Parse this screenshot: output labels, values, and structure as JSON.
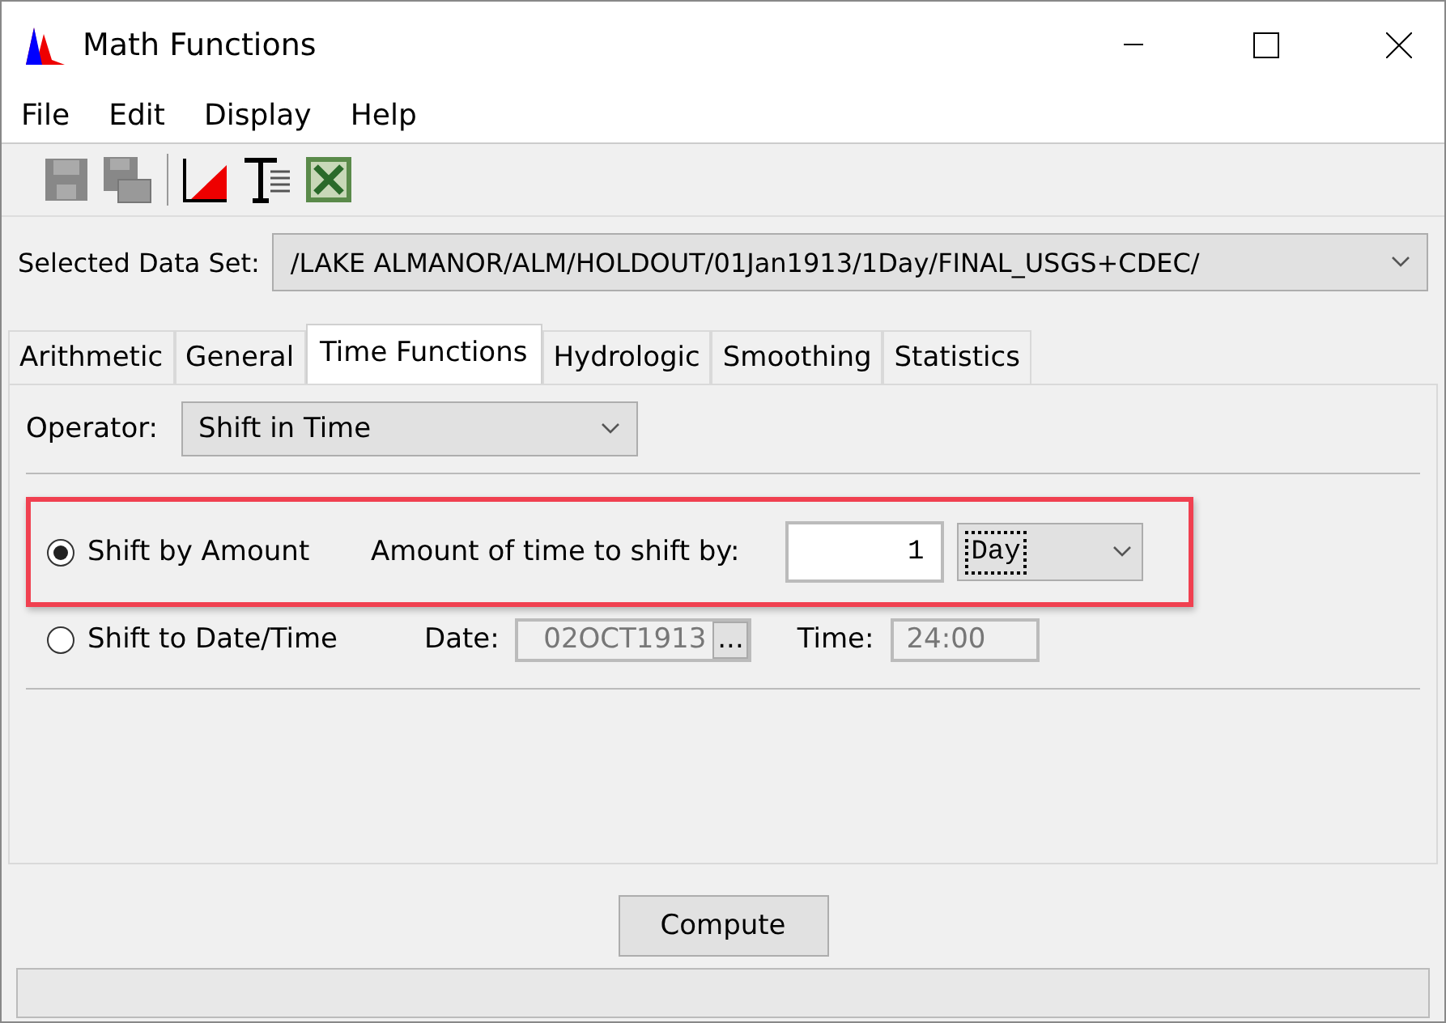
{
  "window": {
    "title": "Math Functions"
  },
  "menu": [
    "File",
    "Edit",
    "Display",
    "Help"
  ],
  "dataset": {
    "label": "Selected Data Set:",
    "value": "/LAKE ALMANOR/ALM/HOLDOUT/01Jan1913/1Day/FINAL_USGS+CDEC/"
  },
  "tabs": [
    {
      "label": "Arithmetic",
      "selected": false
    },
    {
      "label": "General",
      "selected": false
    },
    {
      "label": "Time Functions",
      "selected": true
    },
    {
      "label": "Hydrologic",
      "selected": false
    },
    {
      "label": "Smoothing",
      "selected": false
    },
    {
      "label": "Statistics",
      "selected": false
    }
  ],
  "operator": {
    "label": "Operator:",
    "value": "Shift in Time"
  },
  "shift_by_amount": {
    "label": "Shift by Amount",
    "selected": true,
    "amount_label": "Amount of time to shift by:",
    "amount": "1",
    "unit": "Day"
  },
  "shift_to_date": {
    "label": "Shift to Date/Time",
    "selected": false,
    "date_label": "Date:",
    "date": "02OCT1913",
    "date_button": "...",
    "time_label": "Time:",
    "time": "24:00"
  },
  "compute_button": "Compute"
}
